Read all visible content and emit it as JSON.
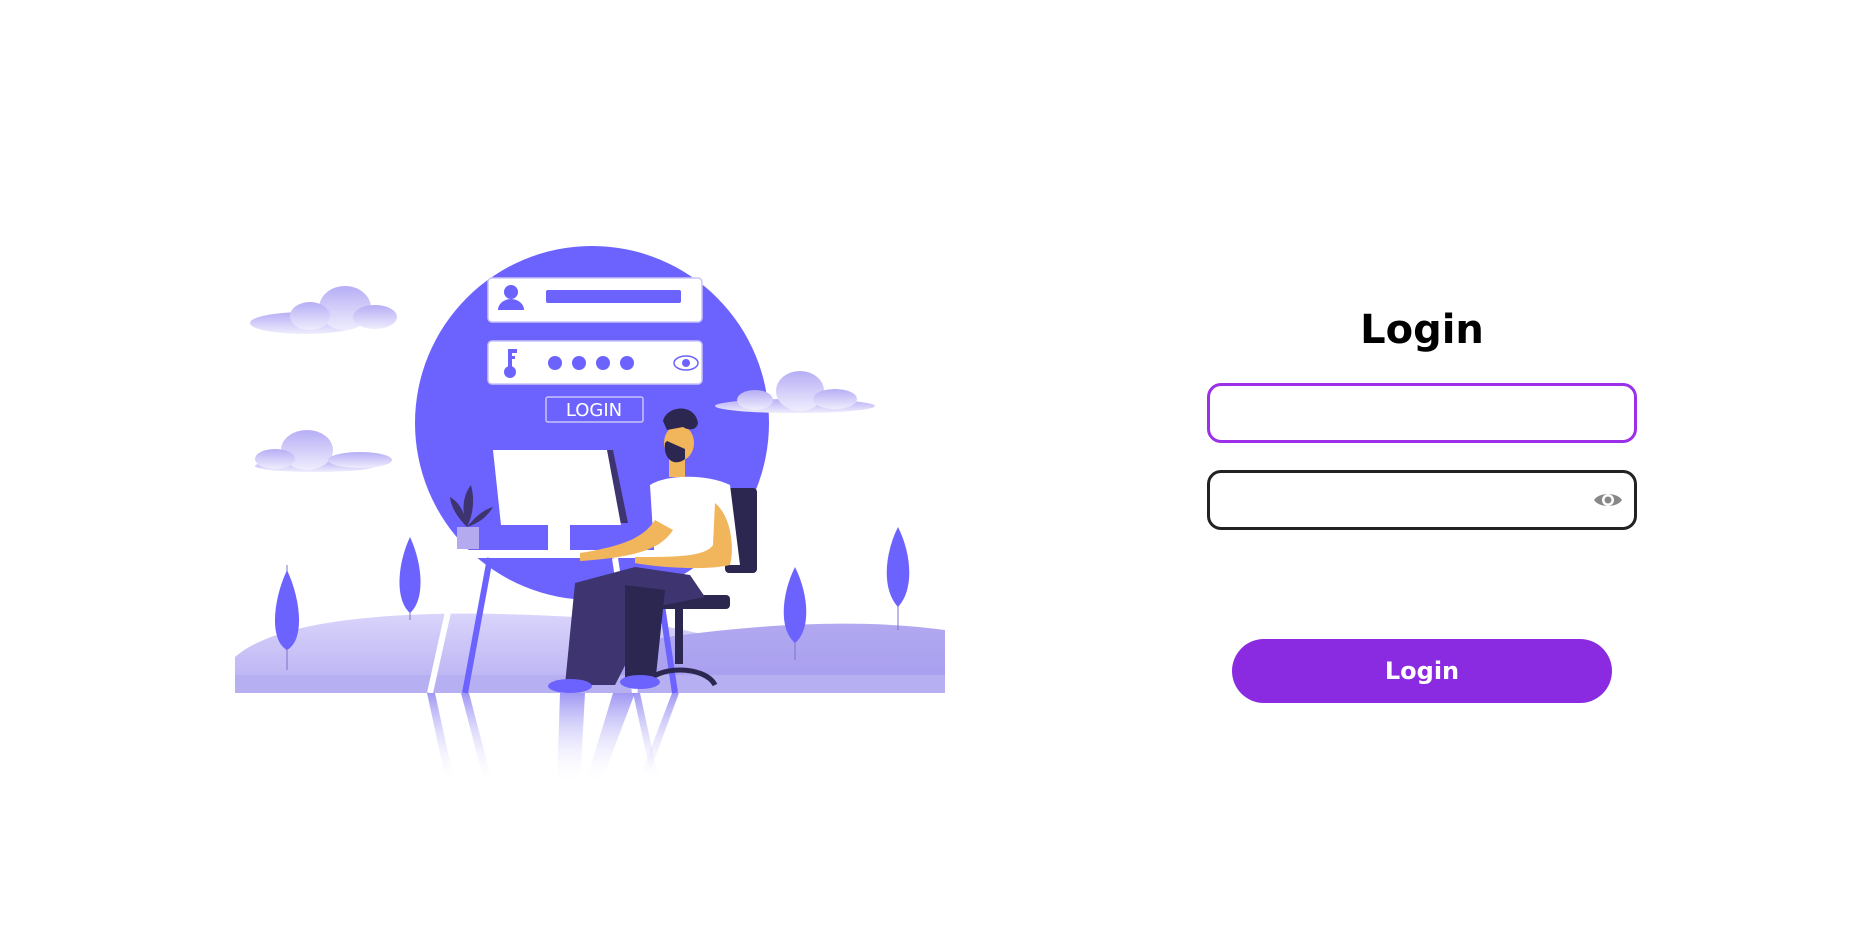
{
  "login": {
    "title": "Login",
    "username": {
      "value": "",
      "placeholder": ""
    },
    "password": {
      "value": "",
      "placeholder": ""
    },
    "password_toggle_icon": "eye-icon",
    "submit_label": "Login"
  },
  "illustration": {
    "login_badge": "LOGIN",
    "icons": [
      "user-icon",
      "key-icon",
      "eye-icon"
    ]
  },
  "colors": {
    "accent": "#8a2be2",
    "username_border": "#9b30e8",
    "password_border": "#222222",
    "illustration_primary": "#6c63ff",
    "illustration_light": "#b3aaf0",
    "eye_icon": "#888888"
  }
}
